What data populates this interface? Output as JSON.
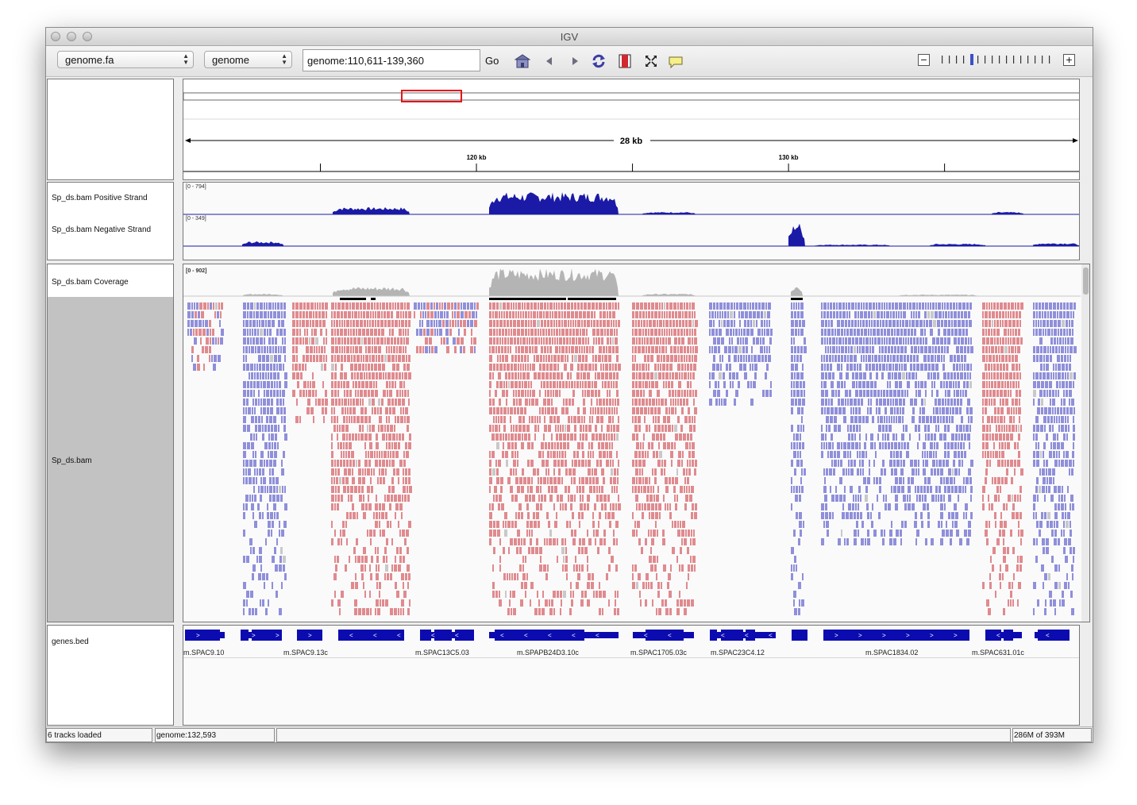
{
  "window": {
    "title": "IGV"
  },
  "toolbar": {
    "genome_select": "genome.fa",
    "chrom_select": "genome",
    "locus": "genome:110,611-139,360",
    "go_label": "Go",
    "icons": [
      "home-icon",
      "back-icon",
      "forward-icon",
      "refresh-icon",
      "roi-icon",
      "fit-to-window-icon",
      "popup-text-icon"
    ],
    "zoom_minus": "−",
    "zoom_plus": "+",
    "zoom_level_fraction": 0.27
  },
  "ruler": {
    "span_label": "28 kb",
    "ticks": [
      "120 kb",
      "130 kb"
    ],
    "view_start": 110611,
    "view_end": 139360,
    "roi_color": "#e3151b"
  },
  "strand_panel": {
    "tracks": [
      {
        "name": "Sp_ds.bam  Positive Strand",
        "range": "[0 - 794]"
      },
      {
        "name": "Sp_ds.bam  Negative Strand",
        "range": "[0 - 349]"
      }
    ],
    "color": "#1a1aa6"
  },
  "alignment_panel": {
    "coverage_name": "Sp_ds.bam Coverage",
    "coverage_range": "[0 - 902]",
    "alignment_name": "Sp_ds.bam",
    "forward_color": "#e08a8e",
    "reverse_color": "#8f8fdb"
  },
  "feature_panel": {
    "name": "genes.bed",
    "genes": [
      "m.SPAC9.10",
      "m.SPAC9.13c",
      "m.SPAC13C5.03",
      "m.SPAPB24D3.10c",
      "m.SPAC1705.03c",
      "m.SPAC23C4.12",
      "m.SPAC1834.02",
      "m.SPAC631.01c"
    ],
    "color": "#0b0bb0"
  },
  "status": {
    "tracks_loaded": "6 tracks loaded",
    "position": "genome:132,593",
    "message": "",
    "memory": "286M of 393M"
  }
}
